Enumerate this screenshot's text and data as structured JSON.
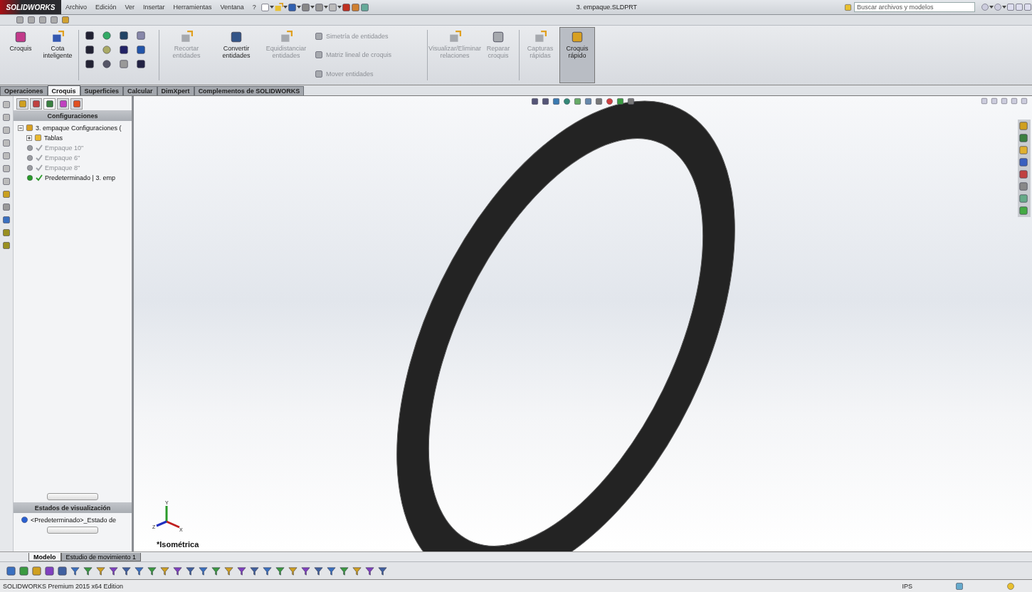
{
  "title_bar": {
    "logo": "SOLIDWORKS",
    "menus": [
      "Archivo",
      "Edición",
      "Ver",
      "Insertar",
      "Herramientas",
      "Ventana",
      "?"
    ],
    "document_title": "3. empaque.SLDPRT",
    "search": {
      "placeholder": "Buscar archivos y modelos"
    }
  },
  "ribbon": {
    "commands": [
      {
        "kind": "large",
        "label": "Croquis",
        "disabled": false,
        "pressed": false
      },
      {
        "kind": "large",
        "label": "Cota inteligente",
        "disabled": false,
        "pressed": false
      },
      {
        "kind": "grid"
      },
      {
        "kind": "large",
        "label": "Recortar entidades",
        "disabled": true,
        "pressed": false
      },
      {
        "kind": "large",
        "label": "Convertir entidades",
        "disabled": false,
        "pressed": false
      },
      {
        "kind": "large",
        "label": "Equidistanciar entidades",
        "disabled": true,
        "pressed": false
      },
      {
        "kind": "list",
        "items": [
          {
            "label": "Simetría de entidades",
            "disabled": true
          },
          {
            "label": "Matriz lineal de croquis",
            "disabled": true
          },
          {
            "label": "Mover entidades",
            "disabled": true
          }
        ]
      },
      {
        "kind": "large",
        "label": "Visualizar/Eliminar relaciones",
        "disabled": true,
        "pressed": false
      },
      {
        "kind": "large",
        "label": "Reparar croquis",
        "disabled": true,
        "pressed": false
      },
      {
        "kind": "large",
        "label": "Capturas rápidas",
        "disabled": true,
        "pressed": false
      },
      {
        "kind": "large",
        "label": "Croquis rápido",
        "disabled": false,
        "pressed": true
      }
    ]
  },
  "command_tabs": [
    {
      "label": "Operaciones",
      "selected": false
    },
    {
      "label": "Croquis",
      "selected": true
    },
    {
      "label": "Superficies",
      "selected": false
    },
    {
      "label": "Calcular",
      "selected": false
    },
    {
      "label": "DimXpert",
      "selected": false
    },
    {
      "label": "Complementos de SOLIDWORKS",
      "selected": false
    }
  ],
  "feature_manager": {
    "panel_tabs": [
      {
        "selected": false
      },
      {
        "selected": false
      },
      {
        "selected": true
      },
      {
        "selected": false
      },
      {
        "selected": false
      }
    ],
    "header": "Configuraciones",
    "tree": [
      {
        "label": "3. empaque Configuraciones (",
        "expanded": true,
        "children": [
          {
            "label": "Tablas",
            "kind": "folder",
            "expanded": false
          },
          {
            "label": "Empaque 10\"",
            "kind": "config",
            "active": false
          },
          {
            "label": "Empaque 6\"",
            "kind": "config",
            "active": false
          },
          {
            "label": "Empaque 8\"",
            "kind": "config",
            "active": false
          },
          {
            "label": "Predeterminado | 3. emp",
            "kind": "config",
            "active": true
          }
        ]
      }
    ]
  },
  "display_states": {
    "header": "Estados de visualización",
    "items": [
      {
        "label": "<Predeterminado>_Estado de"
      }
    ]
  },
  "viewport": {
    "view_name": "*Isométrica",
    "triad": {
      "x": "X",
      "y": "Y",
      "z": "Z"
    }
  },
  "bottom_tabs": [
    {
      "label": "Modelo",
      "selected": true
    },
    {
      "label": "Estudio de movimiento 1",
      "selected": false
    }
  ],
  "status_bar": {
    "product": "SOLIDWORKS Premium 2015 x64 Edition",
    "units": "IPS"
  }
}
